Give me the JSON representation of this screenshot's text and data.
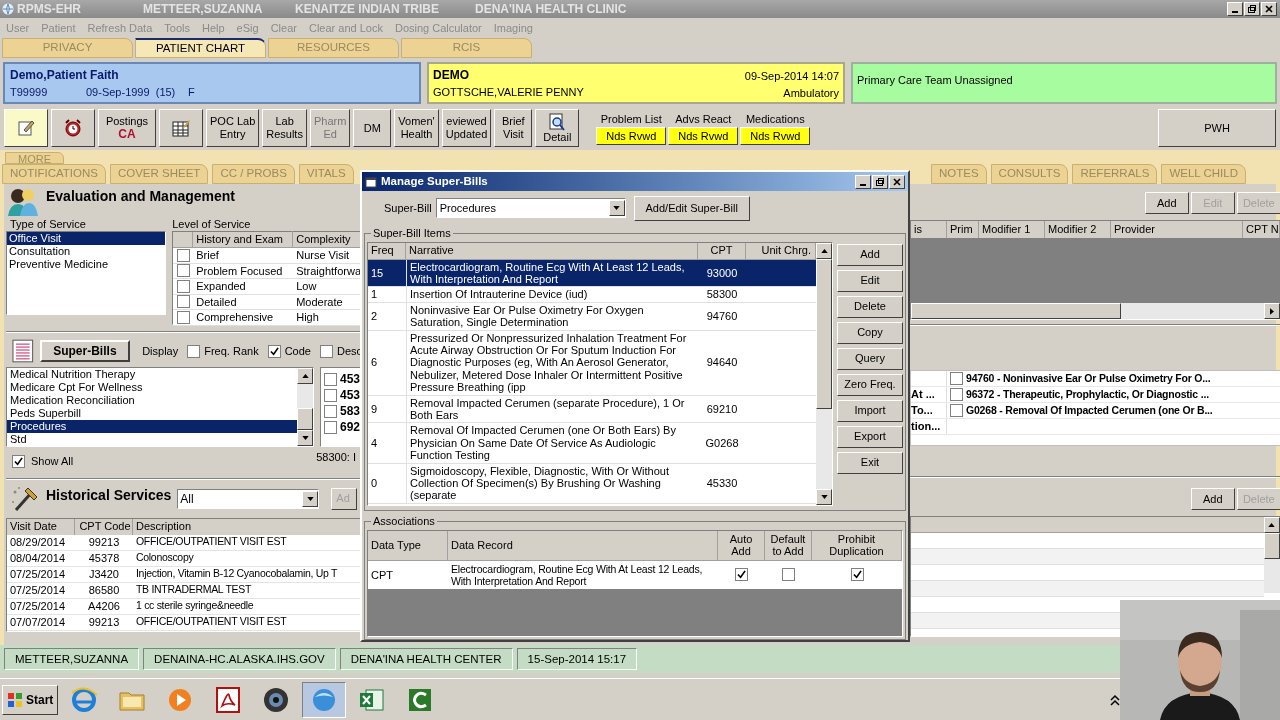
{
  "title_bar": {
    "app": "RPMS-EHR",
    "user": "METTEER,SUZANNA",
    "tribe": "KENAITZE INDIAN TRIBE",
    "clinic": "DENA'INA HEALTH CLINIC"
  },
  "menu": [
    "User",
    "Patient",
    "Refresh Data",
    "Tools",
    "Help",
    "eSig",
    "Clear",
    "Clear and Lock",
    "Dosing Calculator",
    "Imaging"
  ],
  "top_tabs": [
    {
      "label": "PRIVACY",
      "selected": false
    },
    {
      "label": "PATIENT CHART",
      "selected": true
    },
    {
      "label": "RESOURCES",
      "selected": false
    },
    {
      "label": "RCIS",
      "selected": false
    }
  ],
  "patient": {
    "name": "Demo,Patient Faith",
    "id": "T99999",
    "dob": "09-Sep-1999  (15)",
    "sex": "F"
  },
  "visit": {
    "location": "DEMO",
    "provider": "GOTTSCHE,VALERIE PENNY",
    "datetime": "09-Sep-2014 14:07",
    "type": "Ambulatory"
  },
  "care_team": "Primary Care Team Unassigned",
  "toolbar": [
    {
      "kind": "icon",
      "highlighted": true
    },
    {
      "kind": "icon",
      "highlighted": false
    },
    {
      "kind": "postings",
      "label": "Postings",
      "flag": "CA",
      "highlighted": false
    },
    {
      "kind": "icon",
      "highlighted": false
    },
    {
      "kind": "text",
      "label": "POC Lab\nEntry",
      "disabled": false,
      "highlighted": false
    },
    {
      "kind": "text",
      "label": "Lab\nResults",
      "disabled": false,
      "highlighted": false
    },
    {
      "kind": "text",
      "label": "Pharm\nEd",
      "disabled": true,
      "highlighted": false
    },
    {
      "kind": "text",
      "label": "DM",
      "disabled": false,
      "highlighted": false
    },
    {
      "kind": "text",
      "label": "Vomen'\nHealth",
      "disabled": false,
      "highlighted": false
    },
    {
      "kind": "text",
      "label": "eviewed\nUpdated",
      "disabled": false,
      "highlighted": false
    },
    {
      "kind": "text",
      "label": "Brief\nVisit",
      "disabled": false,
      "highlighted": false
    },
    {
      "kind": "detail",
      "label": "Detail",
      "highlighted": false
    }
  ],
  "reviews": [
    {
      "label": "Problem List",
      "status": "Nds Rvwd"
    },
    {
      "label": "Advs React",
      "status": "Nds Rvwd"
    },
    {
      "label": "Medications",
      "status": "Nds Rvwd"
    }
  ],
  "pwh_button": "PWH",
  "more_tab": "MORE",
  "chart_tabs_left": [
    {
      "label": "NOTIFICATIONS",
      "selected": false
    },
    {
      "label": "COVER SHEET",
      "selected": false
    },
    {
      "label": "CC / PROBS",
      "selected": false
    },
    {
      "label": "VITALS",
      "selected": false
    }
  ],
  "chart_tabs_right": [
    {
      "label": "NOTES",
      "selected": false
    },
    {
      "label": "CONSULTS",
      "selected": false
    },
    {
      "label": "REFERRALS",
      "selected": false
    },
    {
      "label": "WELL CHILD",
      "selected": false
    }
  ],
  "em": {
    "title": "Evaluation and Management",
    "type_label": "Type of Service",
    "level_label": "Level of Service",
    "types": [
      {
        "label": "Office Visit",
        "selected": true
      },
      {
        "label": "Consultation",
        "selected": false
      },
      {
        "label": "Preventive Medicine",
        "selected": false
      }
    ],
    "level_columns": [
      "History and Exam",
      "Complexity"
    ],
    "levels": [
      {
        "exam": "Brief",
        "complexity": "Nurse Visit",
        "checked": false
      },
      {
        "exam": "Problem Focused",
        "complexity": "Straightforwa",
        "checked": false
      },
      {
        "exam": "Expanded",
        "complexity": "Low",
        "checked": false
      },
      {
        "exam": "Detailed",
        "complexity": "Moderate",
        "checked": false
      },
      {
        "exam": "Comprehensive",
        "complexity": "High",
        "checked": false
      }
    ]
  },
  "superbills": {
    "button": "Super-Bills",
    "display_label": "Display",
    "display_options": [
      {
        "label": "Freq. Rank",
        "checked": false
      },
      {
        "label": "Code",
        "checked": true
      },
      {
        "label": "Desc",
        "checked": false
      }
    ],
    "list": [
      {
        "label": "Medical Nutrition Therapy",
        "selected": false
      },
      {
        "label": "Medicare Cpt For Wellness",
        "selected": false
      },
      {
        "label": "Medication Reconciliation",
        "selected": false
      },
      {
        "label": "Peds Superbill",
        "selected": false
      },
      {
        "label": "Procedures",
        "selected": true
      },
      {
        "label": "Std",
        "selected": false
      }
    ],
    "codes": [
      {
        "code": "453",
        "checked": false
      },
      {
        "code": "453",
        "checked": false
      },
      {
        "code": "583",
        "checked": false
      },
      {
        "code": "692",
        "checked": false
      }
    ],
    "show_all": {
      "label": "Show All",
      "checked": true
    },
    "status": "58300: I"
  },
  "historical": {
    "title": "Historical Services",
    "filter": "All",
    "add_button": "Ad",
    "columns": [
      "Visit Date",
      "CPT Code",
      "Description"
    ],
    "rows": [
      [
        "08/29/2014",
        "99213",
        "OFFICE/OUTPATIENT VISIT EST"
      ],
      [
        "08/04/2014",
        "45378",
        "Colonoscopy"
      ],
      [
        "07/25/2014",
        "J3420",
        "Injection, Vitamin B-12 Cyanocobalamin, Up T"
      ],
      [
        "07/25/2014",
        "86580",
        "TB INTRADERMAL TEST"
      ],
      [
        "07/25/2014",
        "A4206",
        "1 cc sterile syringe&needle"
      ],
      [
        "07/07/2014",
        "99213",
        "OFFICE/OUTPATIENT VISIT EST"
      ]
    ]
  },
  "right_panel": {
    "buttons": [
      {
        "label": "Add",
        "disabled": false
      },
      {
        "label": "Edit",
        "disabled": true
      },
      {
        "label": "Delete",
        "disabled": true
      }
    ],
    "columns": [
      "is",
      "Prim",
      "Modifier 1",
      "Modifier 2",
      "Provider",
      "CPT N"
    ],
    "list": [
      {
        "item": {
          "text": "94760 - Noninvasive Ear Or Pulse Oximetry For O...",
          "checked": false
        }
      },
      {
        "column_1": "At ...",
        "item": {
          "text": "96372 - Therapeutic, Prophylactic, Or Diagnostic ...",
          "checked": false
        }
      },
      {
        "column_1": "To...",
        "item": {
          "text": "G0268 - Removal Of Impacted Cerumen (one Or B...",
          "checked": false
        }
      },
      {
        "column_1": "tion..."
      }
    ],
    "lower_buttons": [
      {
        "label": "Add",
        "disabled": false
      },
      {
        "label": "Delete",
        "disabled": true
      }
    ]
  },
  "dialog": {
    "title": "Manage Super-Bills",
    "superbill_label": "Super-Bill",
    "superbill_value": "Procedures",
    "add_edit_button": "Add/Edit Super-Bill",
    "items_group": "Super-Bill Items",
    "columns": [
      "Freq",
      "Narrative",
      "CPT",
      "Unit Chrg."
    ],
    "items": [
      {
        "freq": "15",
        "narrative": "Electrocardiogram, Routine Ecg With At Least 12 Leads, With Interpretation And Report",
        "cpt": "93000",
        "selected": true
      },
      {
        "freq": "1",
        "narrative": "Insertion Of Intrauterine Device (iud)",
        "cpt": "58300",
        "selected": false
      },
      {
        "freq": "2",
        "narrative": "Noninvasive Ear Or Pulse Oximetry For Oxygen Saturation, Single Determination",
        "cpt": "94760",
        "selected": false
      },
      {
        "freq": "6",
        "narrative": "Pressurized Or Nonpressurized Inhalation Treatment For Acute Airway Obstruction Or For Sputum Induction For Diagnostic Purposes (eg, With An Aerosol Generator, Nebulizer, Metered Dose Inhaler Or Intermittent Positive Pressure Breathing (ipp",
        "cpt": "94640",
        "selected": false
      },
      {
        "freq": "9",
        "narrative": "Removal Impacted Cerumen (separate Procedure), 1 Or Both Ears",
        "cpt": "69210",
        "selected": false
      },
      {
        "freq": "4",
        "narrative": "Removal Of Impacted Cerumen (one Or Both Ears) By Physician On Same Date Of Service As Audiologic Function Testing",
        "cpt": "G0268",
        "selected": false
      },
      {
        "freq": "0",
        "narrative": "Sigmoidoscopy, Flexible, Diagnostic, With Or Without Collection Of Specimen(s) By Brushing Or Washing (separate",
        "cpt": "45330",
        "selected": false
      }
    ],
    "buttons": [
      "Add",
      "Edit",
      "Delete",
      "Copy",
      "Query",
      "Zero Freq.",
      "Import",
      "Export",
      "Exit"
    ],
    "associations_group": "Associations",
    "association_columns": [
      "Data Type",
      "Data Record",
      "Auto\nAdd",
      "Default\nto Add",
      "Prohibit\nDuplication"
    ],
    "associations": [
      {
        "data_type": "CPT",
        "data_record": "Electrocardiogram, Routine Ecg With At Least 12 Leads, With Interpretation And Report",
        "auto_add": true,
        "default_to_add": false,
        "prohibit_duplication": true
      }
    ]
  },
  "status_bar": [
    "METTEER,SUZANNA",
    "DENAINA-HC.ALASKA.IHS.GOV",
    "DENA'INA HEALTH CENTER",
    "15-Sep-2014 15:17"
  ],
  "taskbar": {
    "start": "Start"
  }
}
